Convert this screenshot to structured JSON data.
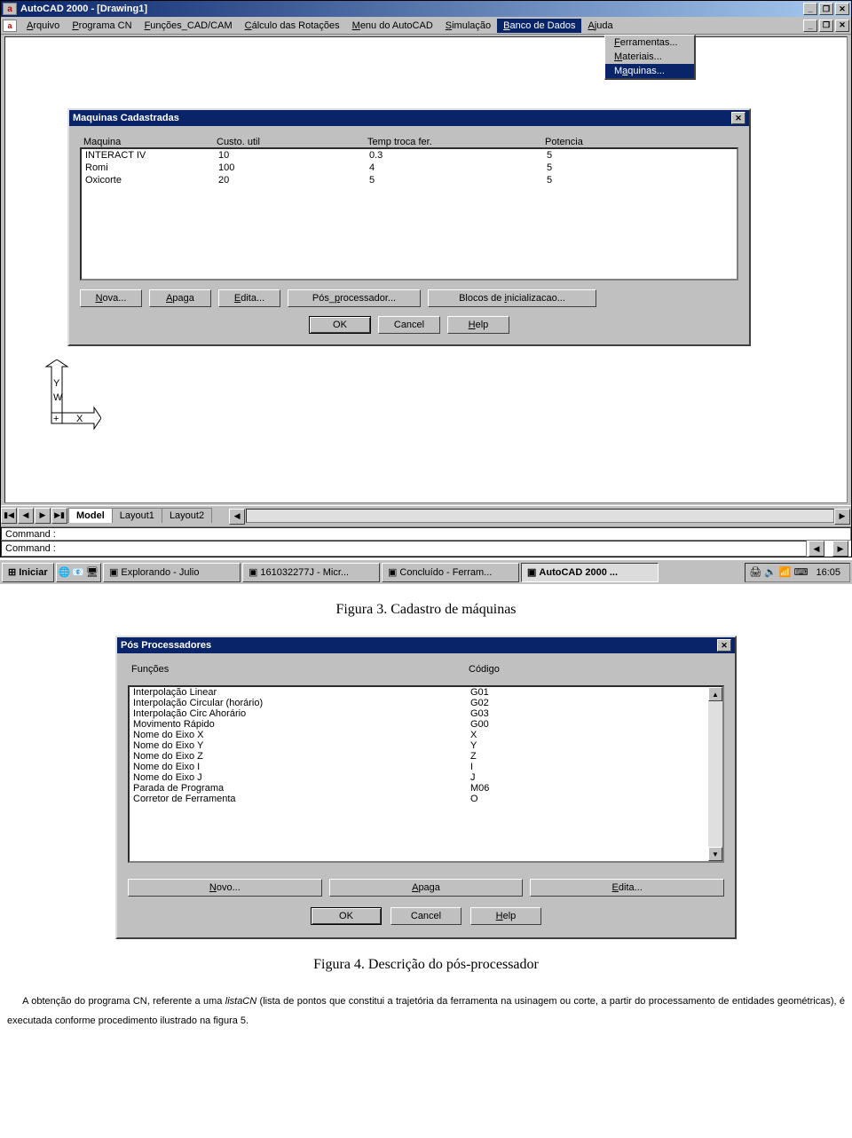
{
  "title": "AutoCAD 2000 - [Drawing1]",
  "menu": {
    "arquivo": "Arquivo",
    "programa": "Programa CN",
    "funcoes": "Funções_CAD/CAM",
    "calculo": "Cálculo das Rotações",
    "menuacad": "Menu do AutoCAD",
    "simulacao": "Simulação",
    "banco": "Banco de Dados",
    "ajuda": "Ajuda"
  },
  "dropdown": {
    "ferramentas": "Ferramentas...",
    "materiais": "Materiais...",
    "maquinas": "Maquinas..."
  },
  "dialog1": {
    "title": "Maquinas Cadastradas",
    "cols": {
      "c1": "Maquina",
      "c2": "Custo. util",
      "c3": "Temp troca fer.",
      "c4": "Potencia"
    },
    "rows": [
      {
        "c1": "INTERACT IV",
        "c2": "10",
        "c3": "0.3",
        "c4": "5"
      },
      {
        "c1": "Romi",
        "c2": "100",
        "c3": "4",
        "c4": "5"
      },
      {
        "c1": "Oxicorte",
        "c2": "20",
        "c3": "5",
        "c4": "5"
      }
    ],
    "btns": {
      "nova": "Nova...",
      "apaga": "Apaga",
      "edita": "Edita...",
      "pos": "Pós_processador...",
      "blocos": "Blocos de inicializacao...",
      "ok": "OK",
      "cancel": "Cancel",
      "help": "Help"
    }
  },
  "sheets": {
    "model": "Model",
    "l1": "Layout1",
    "l2": "Layout2"
  },
  "cmdprompt": "Command :",
  "taskbar": {
    "start": "Iniciar",
    "tasks": [
      {
        "label": "Explorando - Julio"
      },
      {
        "label": "161032277J - Micr..."
      },
      {
        "label": "Concluído - Ferram..."
      },
      {
        "label": "AutoCAD 2000 ...",
        "active": true
      }
    ],
    "clock": "16:05"
  },
  "caption1": "Figura 3. Cadastro de máquinas",
  "dialog2": {
    "title": "Pós Processadores",
    "cols": {
      "f": "Funções",
      "c": "Código"
    },
    "rows": [
      {
        "f": "Interpolação Linear",
        "c": "G01"
      },
      {
        "f": "Interpolação Circular (horário)",
        "c": "G02"
      },
      {
        "f": "Interpolação Circ Ahorário",
        "c": "G03"
      },
      {
        "f": "Movimento Rápido",
        "c": "G00"
      },
      {
        "f": "Nome do Eixo X",
        "c": "X"
      },
      {
        "f": "Nome do Eixo Y",
        "c": "Y"
      },
      {
        "f": "Nome do Eixo Z",
        "c": "Z"
      },
      {
        "f": "Nome do Eixo I",
        "c": "I"
      },
      {
        "f": "Nome do Eixo J",
        "c": "J"
      },
      {
        "f": "Parada de Programa",
        "c": "M06"
      },
      {
        "f": "Corretor de Ferramenta",
        "c": "O"
      }
    ],
    "btns": {
      "novo": "Novo...",
      "apaga": "Apaga",
      "edita": "Edita...",
      "ok": "OK",
      "cancel": "Cancel",
      "help": "Help"
    }
  },
  "caption2": "Figura 4. Descrição do pós-processador",
  "paragraph_before": "A obtenção do programa CN, referente a uma ",
  "paragraph_em": "listaCN",
  "paragraph_after": " (lista de pontos que constitui a trajetória da ferramenta na usinagem ou corte, a partir do processamento de entidades geométricas), é executada conforme procedimento ilustrado na figura 5."
}
